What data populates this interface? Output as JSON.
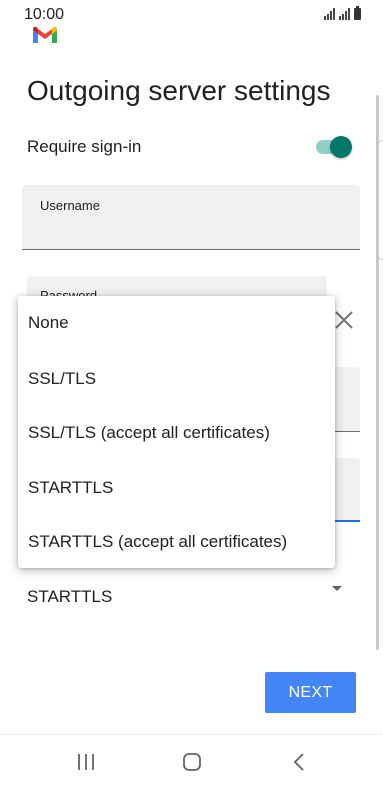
{
  "status_bar": {
    "time": "10:00",
    "icons": [
      "signal-icon",
      "signal-icon",
      "battery-icon"
    ]
  },
  "app": {
    "logo": "gmail-logo",
    "accent_color": "#00796b",
    "button_color": "#4285f4"
  },
  "page": {
    "title": "Outgoing server settings"
  },
  "form": {
    "require_signin": {
      "label": "Require sign-in",
      "checked": true
    },
    "username": {
      "label": "Username",
      "value": ""
    },
    "password": {
      "label": "Password"
    },
    "security_type": {
      "selected": "STARTTLS",
      "options": [
        "None",
        "SSL/TLS",
        "SSL/TLS (accept all certificates)",
        "STARTTLS",
        "STARTTLS (accept all certificates)"
      ]
    },
    "next_label": "NEXT"
  },
  "nav_bar": {
    "icons": [
      "recent-apps-icon",
      "home-icon",
      "back-icon"
    ]
  }
}
